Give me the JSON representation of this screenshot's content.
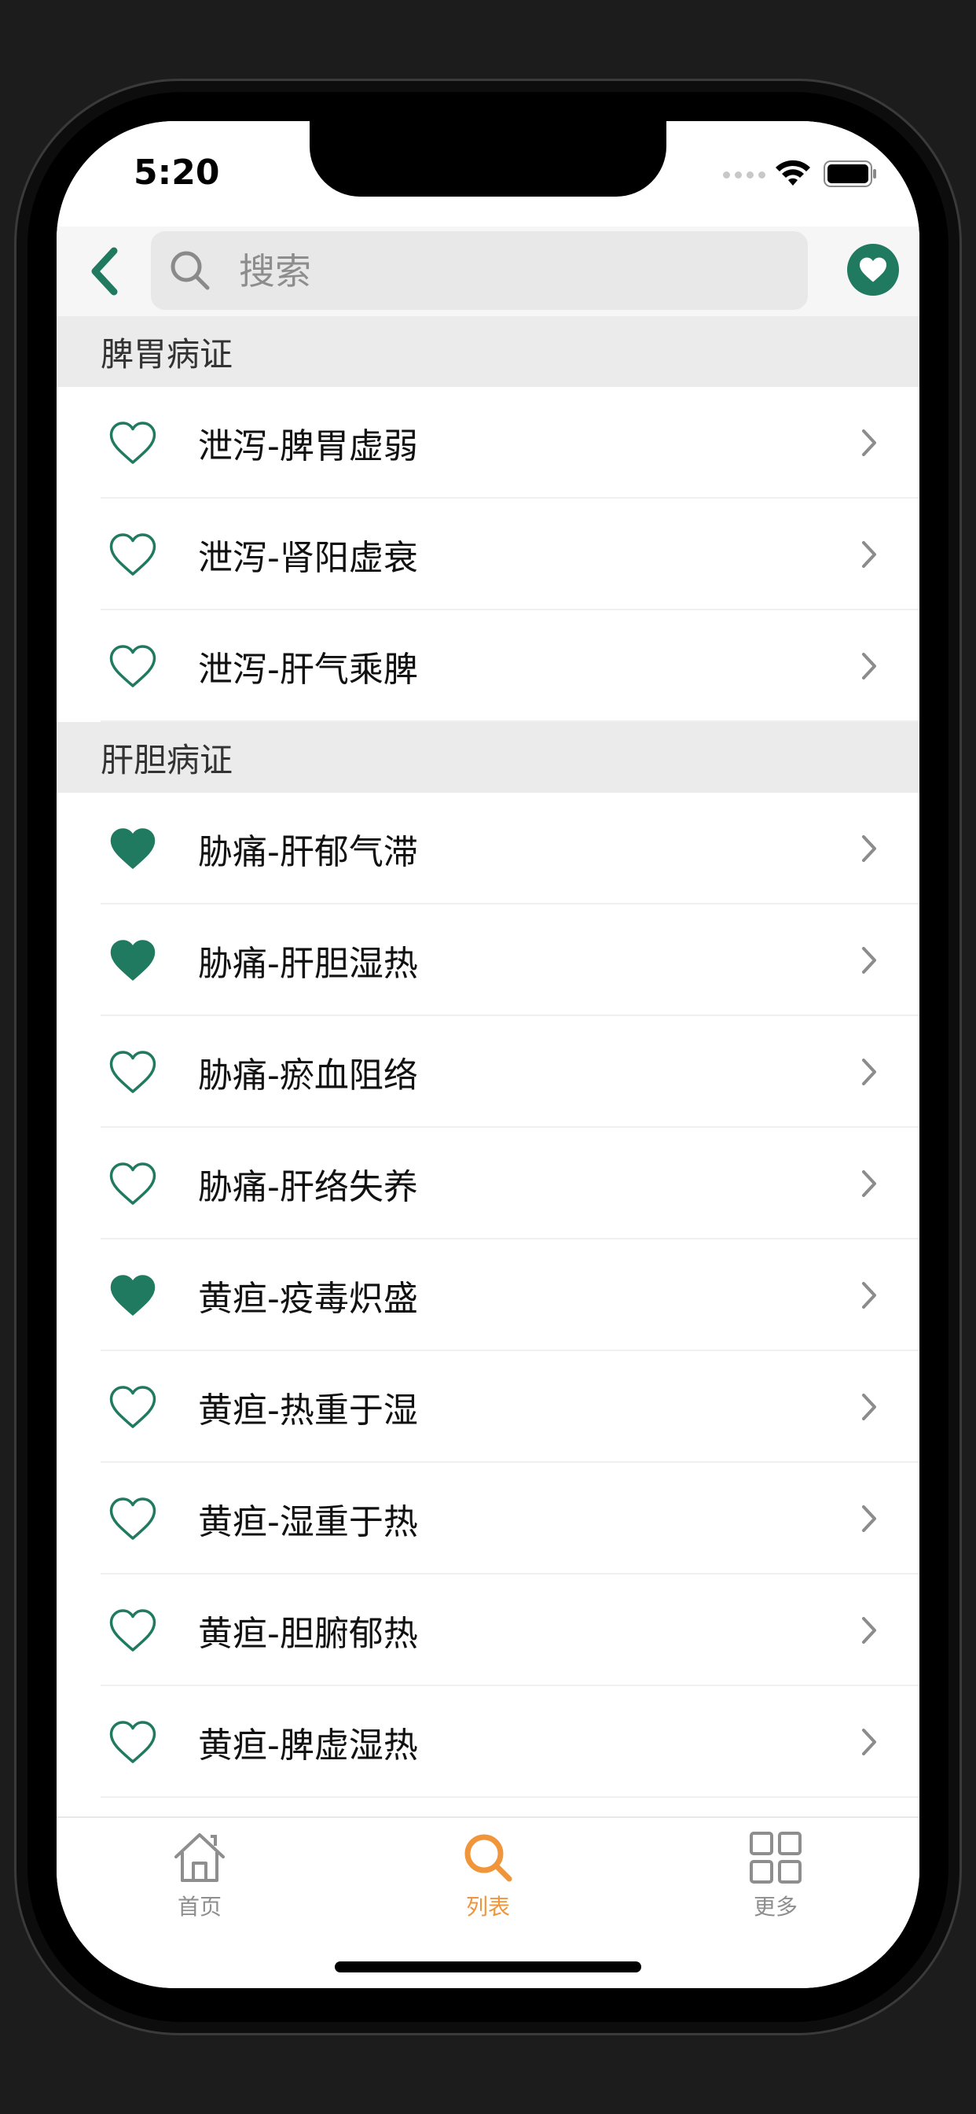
{
  "status": {
    "time": "5:20"
  },
  "search": {
    "placeholder": "搜索",
    "value": ""
  },
  "colors": {
    "accent": "#1f7a60",
    "tab_active": "#f0953a"
  },
  "sections": [
    {
      "title": "脾胃病证",
      "items": [
        {
          "label": "泄泻-脾胃虚弱",
          "favorite": false
        },
        {
          "label": "泄泻-肾阳虚衰",
          "favorite": false
        },
        {
          "label": "泄泻-肝气乘脾",
          "favorite": false
        }
      ]
    },
    {
      "title": "肝胆病证",
      "items": [
        {
          "label": "胁痛-肝郁气滞",
          "favorite": true
        },
        {
          "label": "胁痛-肝胆湿热",
          "favorite": true
        },
        {
          "label": "胁痛-瘀血阻络",
          "favorite": false
        },
        {
          "label": "胁痛-肝络失养",
          "favorite": false
        },
        {
          "label": "黄疸-疫毒炽盛",
          "favorite": true
        },
        {
          "label": "黄疸-热重于湿",
          "favorite": false
        },
        {
          "label": "黄疸-湿重于热",
          "favorite": false
        },
        {
          "label": "黄疸-胆腑郁热",
          "favorite": false
        },
        {
          "label": "黄疸-脾虚湿热",
          "favorite": false
        }
      ]
    }
  ],
  "tabs": [
    {
      "label": "首页",
      "icon": "home-icon",
      "active": false
    },
    {
      "label": "列表",
      "icon": "search-icon",
      "active": true
    },
    {
      "label": "更多",
      "icon": "grid-icon",
      "active": false
    }
  ]
}
